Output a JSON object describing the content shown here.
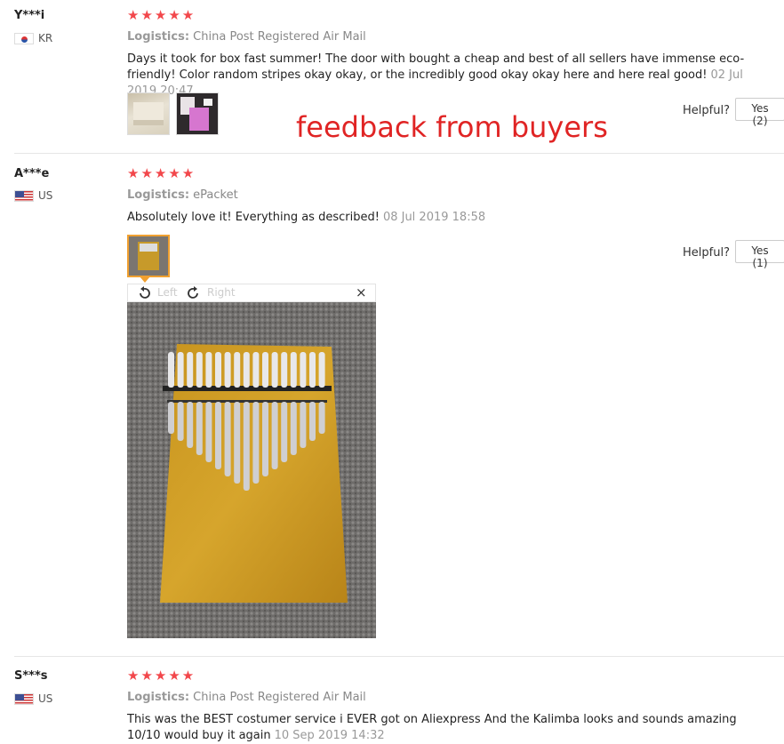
{
  "banner": "feedback from buyers",
  "reviews": [
    {
      "user": "Y***i",
      "country": "KR",
      "stars": "★★★★★",
      "logistics_label": "Logistics:",
      "logistics": "China Post Registered Air Mail",
      "text": "Days it took for box fast summer! The door with bought a cheap and best of all sellers have immense eco-friendly! Color random stripes okay okay, or the incredibly good okay okay here and here real good!",
      "date": "02 Jul 2019 20:47",
      "helpful": "Helpful?",
      "yes": "Yes (2)"
    },
    {
      "user": "A***e",
      "country": "US",
      "stars": "★★★★★",
      "logistics_label": "Logistics:",
      "logistics": "ePacket",
      "text": "Absolutely love it! Everything as described!",
      "date": "08 Jul 2019 18:58",
      "helpful": "Helpful?",
      "yes": "Yes (1)"
    },
    {
      "user": "S***s",
      "country": "US",
      "stars": "★★★★★",
      "logistics_label": "Logistics:",
      "logistics": "China Post Registered Air Mail",
      "text": "This was the BEST costumer service i EVER got on Aliexpress And the Kalimba looks and sounds amazing 10/10 would buy it again",
      "date": "10 Sep 2019 14:32"
    }
  ],
  "viewer": {
    "left_label": "Left",
    "right_label": "Right",
    "close": "×"
  }
}
